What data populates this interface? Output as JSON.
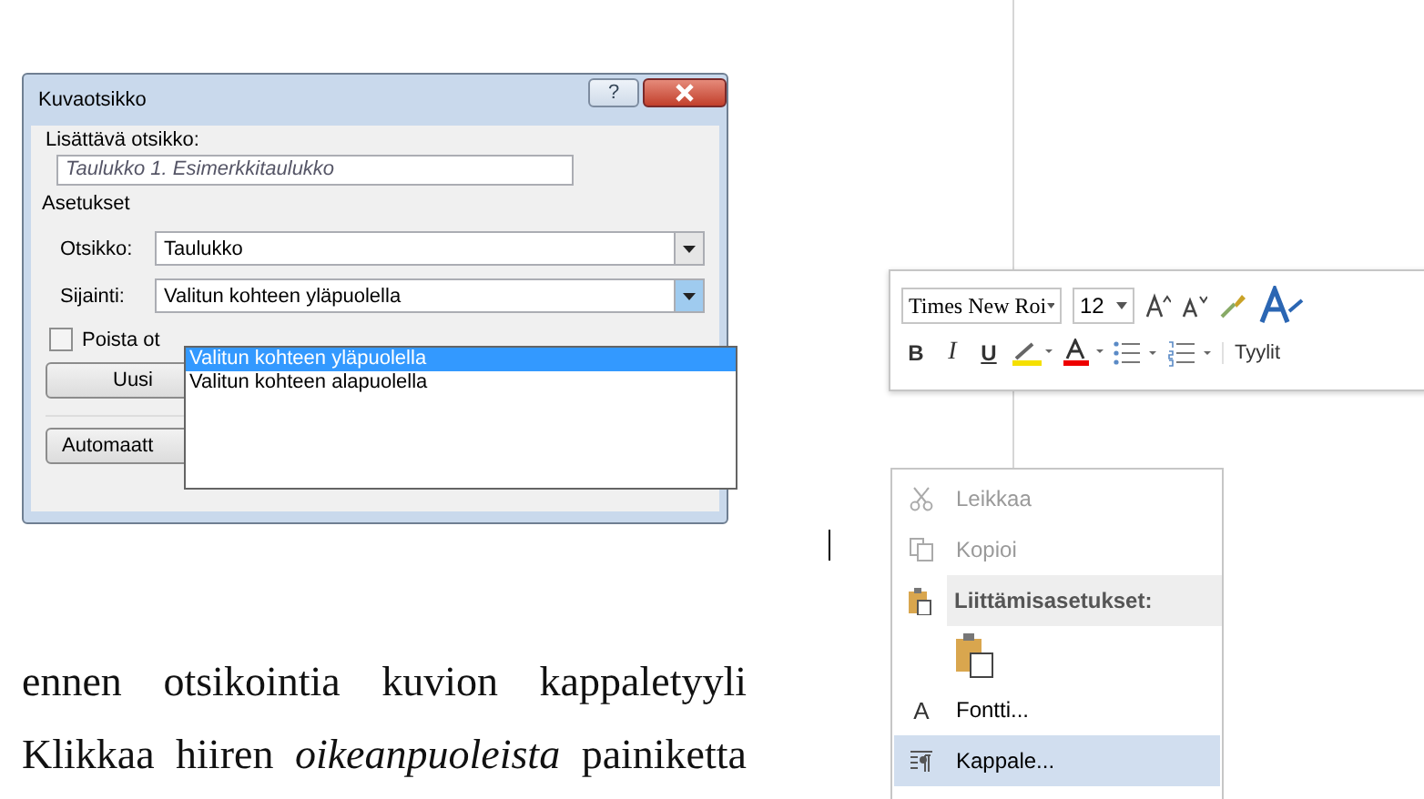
{
  "dialog": {
    "title": "Kuvaotsikko",
    "caption_label": "Lisättävä otsikko:",
    "caption_value": "Taulukko 1. Esimerkkitaulukko",
    "options_heading": "Asetukset",
    "label_field": {
      "label": "Otsikko:",
      "value": "Taulukko"
    },
    "position_field": {
      "label": "Sijainti:",
      "value": "Valitun kohteen yläpuolella",
      "expanded": true
    },
    "position_options": [
      {
        "label": "Valitun kohteen yläpuolella",
        "selected": true
      },
      {
        "label": "Valitun kohteen alapuolella",
        "selected": false
      }
    ],
    "exclude_checkbox": {
      "label": "Poista ot",
      "checked": false
    },
    "new_label_button": "Uusi",
    "auto_caption_button": "Automaatt"
  },
  "help_button": "?",
  "mini_toolbar": {
    "font": "Times New Roi",
    "size": "12",
    "format_buttons": [
      "B",
      "I",
      "U"
    ],
    "styles_label": "Tyylit"
  },
  "context_menu": {
    "items": [
      {
        "kind": "command",
        "label": "Leikkaa",
        "disabled": true,
        "selected": false
      },
      {
        "kind": "command",
        "label": "Kopioi",
        "disabled": true,
        "selected": false
      },
      {
        "kind": "header",
        "label": "Liittämisasetukset:"
      },
      {
        "kind": "paste-option"
      },
      {
        "kind": "command",
        "label": "Fontti...",
        "icon_text": "A",
        "disabled": false,
        "selected": false
      },
      {
        "kind": "command",
        "label": "Kappale...",
        "disabled": false,
        "selected": true
      }
    ]
  },
  "document": {
    "lines": [
      "ennen otsikointia kuvion kappaletyyli",
      "Klikkaa hiiren *oikeanpuoleista* painiketta"
    ]
  }
}
